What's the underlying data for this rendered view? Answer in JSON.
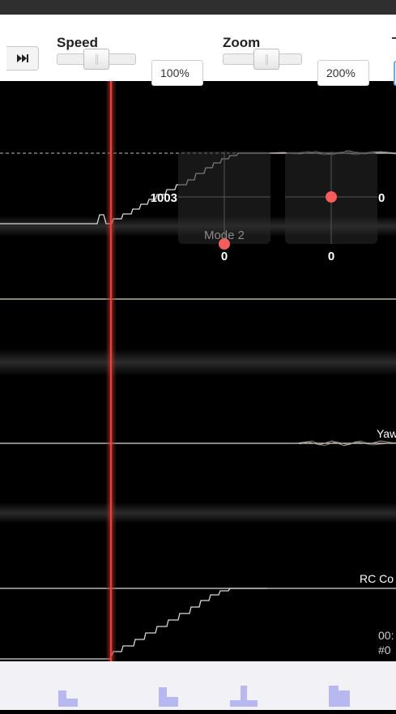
{
  "toolbar": {
    "speed_label": "Speed",
    "zoom_label": "Zoom",
    "speed_value": "100%",
    "zoom_value": "200%",
    "speed_slider_level": 0.5,
    "zoom_slider_level": 0.5
  },
  "graph": {
    "sticks": {
      "left_value_x": "1003",
      "left_value_y": "0",
      "right_value_x": "0",
      "right_value_y": "0",
      "mode_label": "Mode 2"
    },
    "yaw_label": "Yaw",
    "rc_label": "RC Co",
    "time_label": "00:",
    "frame_label": "#0"
  },
  "colors": {
    "cursor": "#d6403a",
    "stick_dot": "#f55c5c",
    "trace": "#d9d9d9",
    "link_accent": "#66afe9"
  }
}
